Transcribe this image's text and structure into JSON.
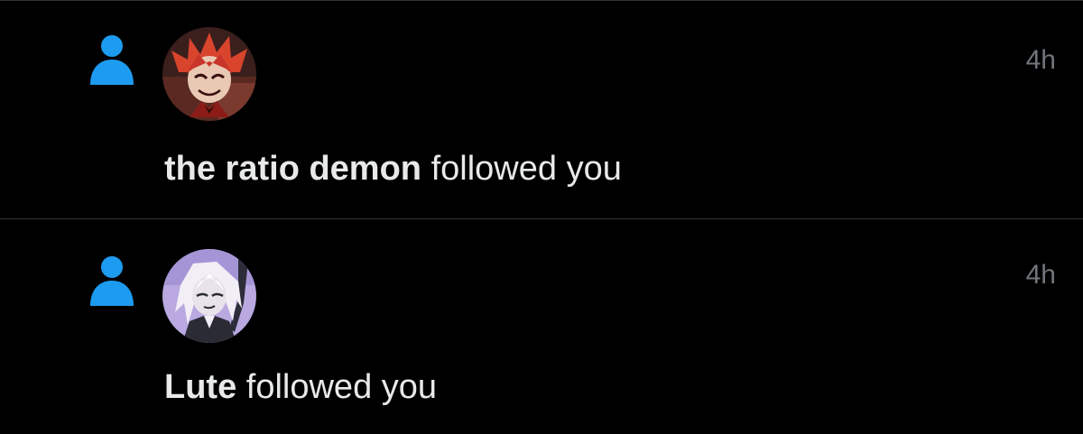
{
  "colors": {
    "background": "#000000",
    "text": "#e7e9ea",
    "muted": "#71767b",
    "accent": "#1d9bf0",
    "divider": "#2f3336"
  },
  "notifications": [
    {
      "icon": "person-icon",
      "avatar": "avatar-red-haired-character",
      "username": "the ratio demon",
      "action": " followed you",
      "time": "4h"
    },
    {
      "icon": "person-icon",
      "avatar": "avatar-white-haired-character",
      "username": "Lute",
      "action": " followed you",
      "time": "4h"
    }
  ]
}
